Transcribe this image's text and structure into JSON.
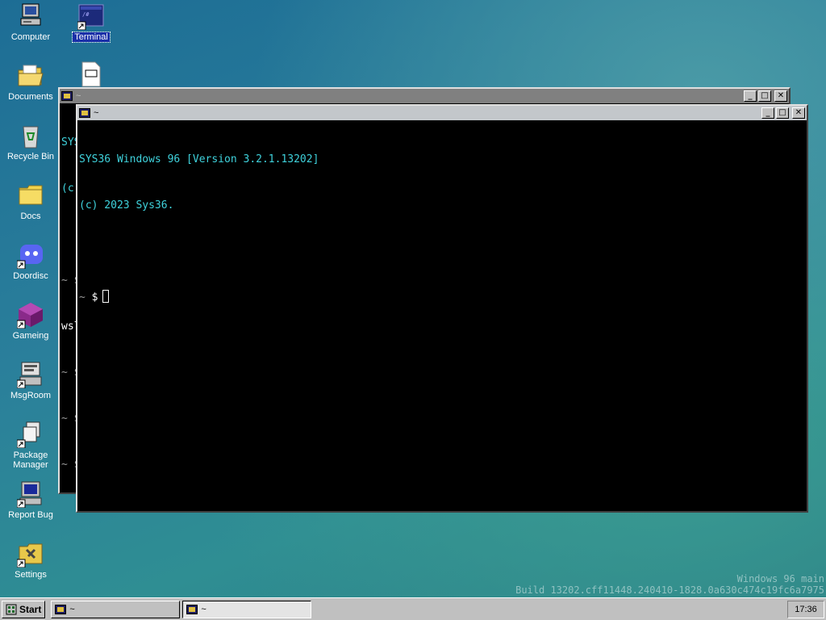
{
  "desktop": {
    "icons": [
      {
        "label": "Computer",
        "icon": "computer-icon"
      },
      {
        "label": "Terminal",
        "icon": "terminal-icon"
      },
      {
        "label": "Documents",
        "icon": "documents-folder-icon"
      },
      {
        "label": "Recycle Bin",
        "icon": "recycle-bin-icon"
      },
      {
        "label": "Docs",
        "icon": "folder-icon"
      },
      {
        "label": "Doordisc",
        "icon": "doordisc-icon"
      },
      {
        "label": "Gameing",
        "icon": "game-cube-icon"
      },
      {
        "label": "MsgRoom",
        "icon": "msgroom-icon"
      },
      {
        "label": "Package Manager",
        "icon": "package-manager-icon"
      },
      {
        "label": "Report Bug",
        "icon": "report-bug-icon"
      },
      {
        "label": "Settings",
        "icon": "settings-icon"
      }
    ],
    "file_icon_glyph": "M↓"
  },
  "back_window": {
    "title": "~",
    "visible_lines": [
      "SYS",
      "(c",
      "",
      "~ $",
      "wsl",
      "~ $",
      "~ $",
      "~ $",
      "~ $"
    ]
  },
  "front_window": {
    "title": "~",
    "lines": [
      "SYS36 Windows 96 [Version 3.2.1.13202]",
      "(c) 2023 Sys36."
    ],
    "prompt_tilde": "~",
    "prompt_symbol": "$"
  },
  "window_buttons": {
    "minimize": "_",
    "maximize": "□",
    "close": "✕"
  },
  "watermark": {
    "line1": "Windows 96 main",
    "line2": "Build 13202.cff11448.240410-1828.0a630c474c19fc6a7975"
  },
  "taskbar": {
    "start_label": "Start",
    "tasks": [
      {
        "label": "~",
        "active": false
      },
      {
        "label": "~",
        "active": true
      }
    ],
    "clock": "17:36"
  },
  "colors": {
    "terminal_text": "#3fd2dc",
    "selection": "#1a2fa8"
  }
}
